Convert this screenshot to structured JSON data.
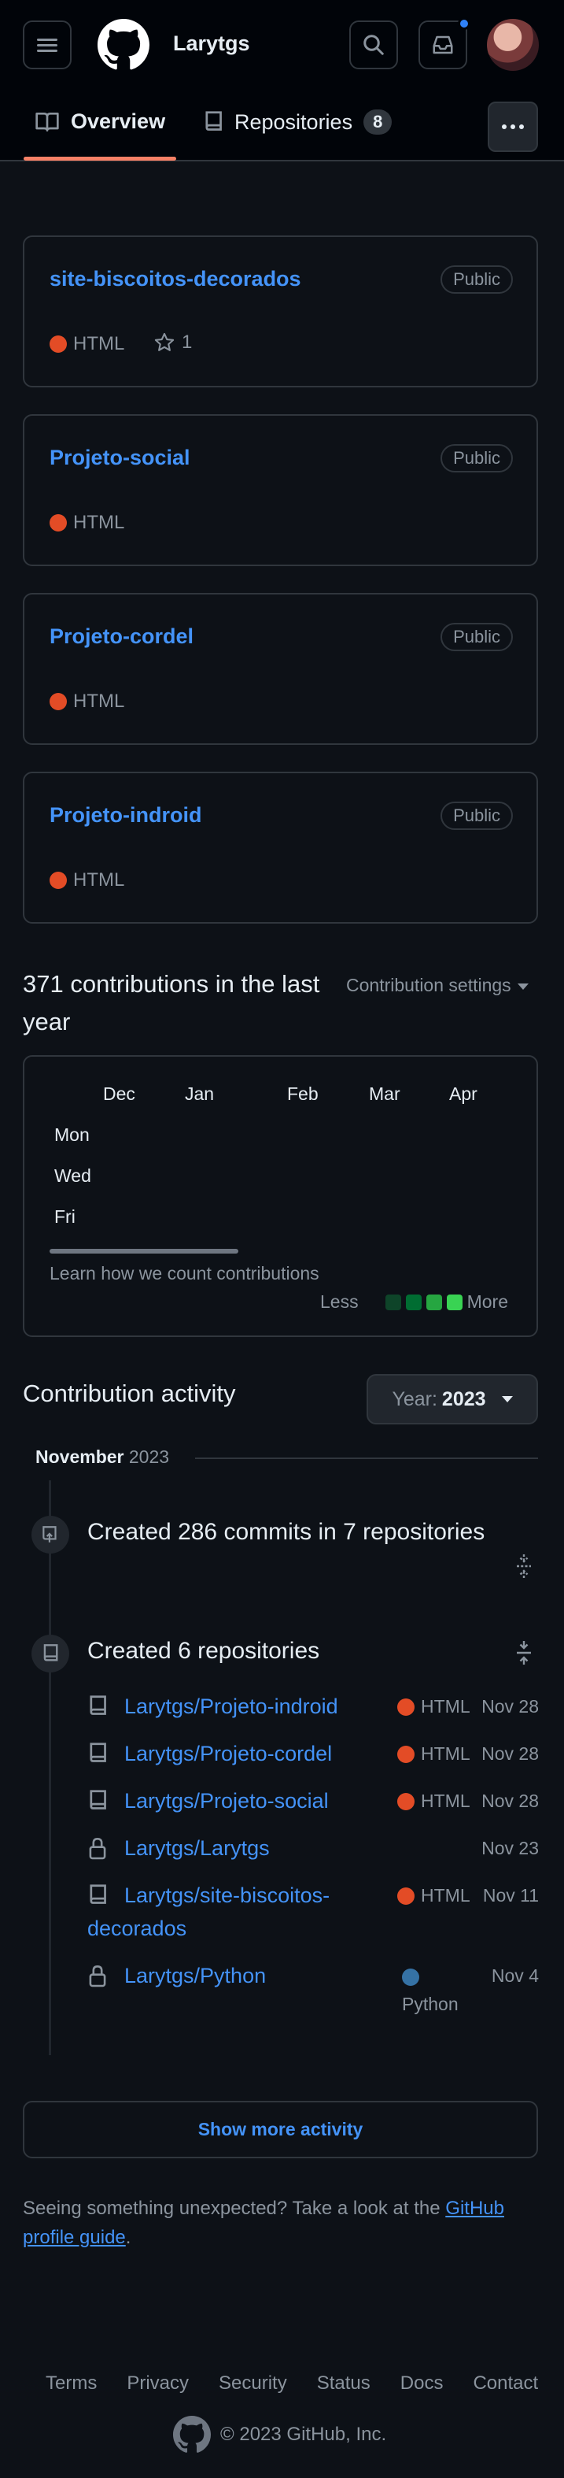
{
  "header": {
    "username": "Larytgs"
  },
  "tabs": {
    "overview": "Overview",
    "repositories": "Repositories",
    "repositories_count": "8"
  },
  "pinned": [
    {
      "name": "site-biscoitos-decorados",
      "visibility": "Public",
      "language": "HTML",
      "language_color": "#e34c26",
      "stars": "1"
    },
    {
      "name": "Projeto-social",
      "visibility": "Public",
      "language": "HTML",
      "language_color": "#e34c26"
    },
    {
      "name": "Projeto-cordel",
      "visibility": "Public",
      "language": "HTML",
      "language_color": "#e34c26"
    },
    {
      "name": "Projeto-indroid",
      "visibility": "Public",
      "language": "HTML",
      "language_color": "#e34c26"
    }
  ],
  "contributions": {
    "title": "371 contributions in the last year",
    "settings": "Contribution settings",
    "months": [
      "Dec",
      "Jan",
      "Feb",
      "Mar",
      "Apr"
    ],
    "days": [
      "Mon",
      "Wed",
      "Fri"
    ],
    "learn": "Learn how we count contributions",
    "less": "Less",
    "more": "More",
    "legend_colors": [
      "#0e4429",
      "#006d32",
      "#26a641",
      "#39d353"
    ]
  },
  "activity": {
    "title": "Contribution activity",
    "year_label": "Year:",
    "year": "2023",
    "month": "November",
    "month_year": "2023",
    "commits_event": "Created 286 commits in 7 repositories",
    "repos_event": "Created 6 repositories",
    "repos": [
      {
        "name": "Larytgs/Projeto-indroid",
        "language": "HTML",
        "color": "#e34c26",
        "date": "Nov 28",
        "private": false
      },
      {
        "name": "Larytgs/Projeto-cordel",
        "language": "HTML",
        "color": "#e34c26",
        "date": "Nov 28",
        "private": false
      },
      {
        "name": "Larytgs/Projeto-social",
        "language": "HTML",
        "color": "#e34c26",
        "date": "Nov 28",
        "private": false
      },
      {
        "name": "Larytgs/Larytgs",
        "language": "",
        "color": "",
        "date": "Nov 23",
        "private": true
      },
      {
        "name": "Larytgs/site-biscoitos-decorados",
        "language": "HTML",
        "color": "#e34c26",
        "date": "Nov 11",
        "private": false
      },
      {
        "name": "Larytgs/Python",
        "language": "Python",
        "color": "#3572A5",
        "date": "Nov 4",
        "private": true
      }
    ],
    "show_more": "Show more activity"
  },
  "notice": {
    "text": "Seeing something unexpected? Take a look at the",
    "link": "GitHub profile guide",
    "period": "."
  },
  "footer": {
    "links": [
      "Terms",
      "Privacy",
      "Security",
      "Status",
      "Docs",
      "Contact"
    ],
    "copyright": "© 2023 GitHub, Inc."
  }
}
